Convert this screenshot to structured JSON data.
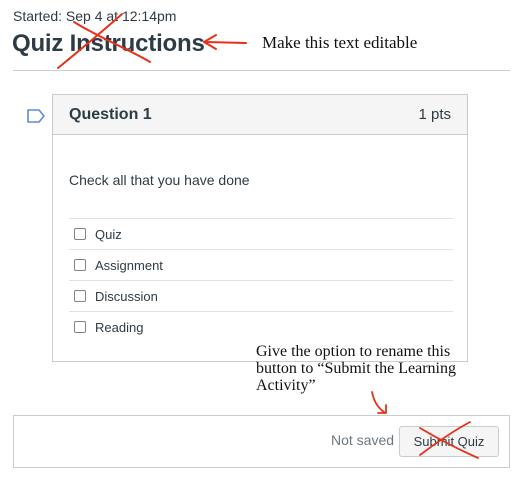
{
  "header": {
    "started_text": "Started: Sep 4 at 12:14pm",
    "title": "Quiz Instructions"
  },
  "question": {
    "title": "Question 1",
    "points": "1 pts",
    "prompt": "Check all that you have done",
    "answers": [
      {
        "label": "Quiz",
        "checked": false
      },
      {
        "label": "Assignment",
        "checked": false
      },
      {
        "label": "Discussion",
        "checked": false
      },
      {
        "label": "Reading",
        "checked": false
      }
    ]
  },
  "footer": {
    "status": "Not saved",
    "submit_label": "Submit Quiz"
  },
  "annotations": {
    "title_note": "Make this text editable",
    "button_note_line1": "Give the option to rename this",
    "button_note_line2": "button to “Submit the Learning",
    "button_note_line3": "Activity”"
  },
  "colors": {
    "annotation_red": "#e8311a",
    "text_primary": "#2d3b45",
    "text_muted": "#6b7780",
    "border": "#c7cdd1",
    "header_bg": "#f5f5f5",
    "flag_blue": "#5a8bd6"
  },
  "icons": {
    "flag": "flag-outline-icon",
    "checkbox": "checkbox-icon"
  }
}
